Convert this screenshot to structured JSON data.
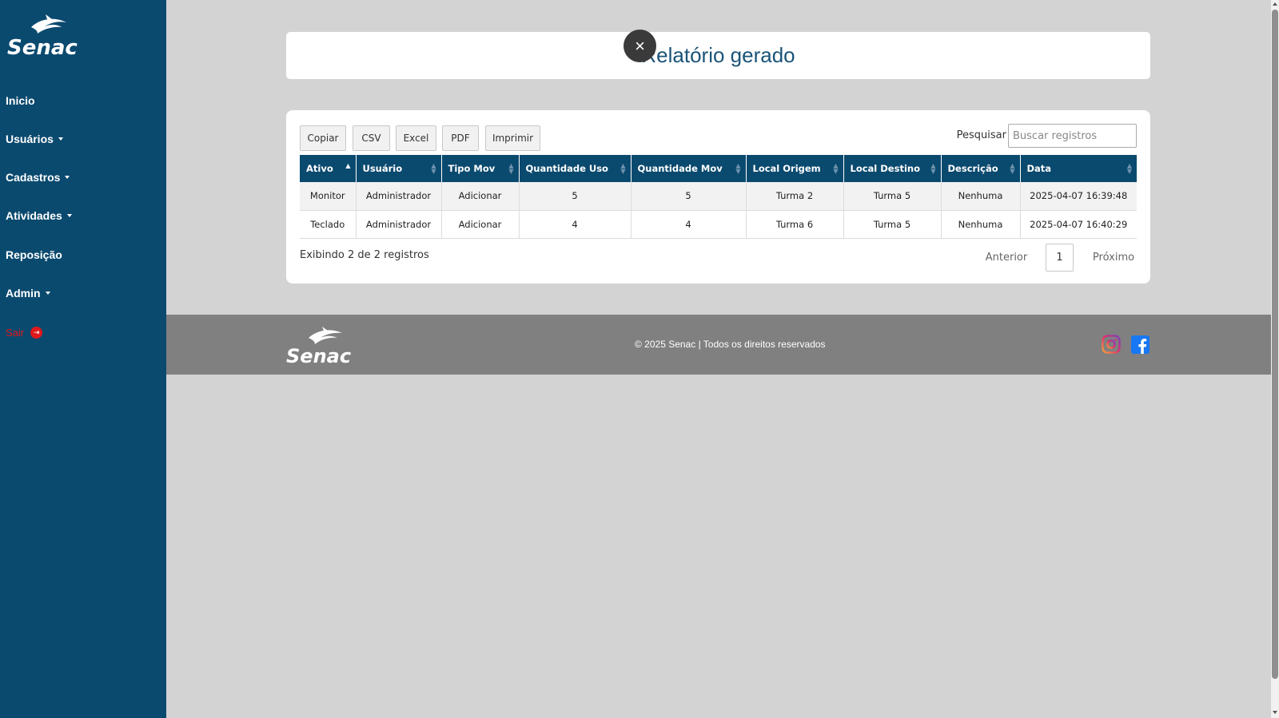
{
  "sidebar": {
    "brand": "Senac",
    "items": [
      {
        "label": "Inicio",
        "dropdown": false
      },
      {
        "label": "Usuários",
        "dropdown": true
      },
      {
        "label": "Cadastros",
        "dropdown": true
      },
      {
        "label": "Atividades",
        "dropdown": true
      },
      {
        "label": "Reposição",
        "dropdown": false
      },
      {
        "label": "Admin",
        "dropdown": true
      }
    ],
    "logout_label": "Sair"
  },
  "header": {
    "title": "Relatório gerado",
    "close_icon": "close-icon"
  },
  "toolbar": {
    "buttons": [
      "Copiar",
      "CSV",
      "Excel",
      "PDF",
      "Imprimir"
    ],
    "search_label": "Pesquisar",
    "search_placeholder": "Buscar registros"
  },
  "table": {
    "columns": [
      "Ativo",
      "Usuário",
      "Tipo Mov",
      "Quantidade Uso",
      "Quantidade Mov",
      "Local Origem",
      "Local Destino",
      "Descrição",
      "Data"
    ],
    "sorted_column": "Ativo",
    "rows": [
      [
        "Monitor",
        "Administrador",
        "Adicionar",
        "5",
        "5",
        "Turma 2",
        "Turma 5",
        "Nenhuma",
        "2025-04-07 16:39:48"
      ],
      [
        "Teclado",
        "Administrador",
        "Adicionar",
        "4",
        "4",
        "Turma 6",
        "Turma 5",
        "Nenhuma",
        "2025-04-07 16:40:29"
      ]
    ]
  },
  "pagination": {
    "info": "Exibindo 2 de 2 registros",
    "previous": "Anterior",
    "current_page": "1",
    "next": "Próximo"
  },
  "footer": {
    "brand": "Senac",
    "copyright": "© 2025 Senac | Todos os direitos reservados",
    "social_icons": [
      "instagram-icon",
      "facebook-icon"
    ]
  },
  "colors": {
    "sidebar": "#0b4a6f",
    "table_header": "#0b4a6f",
    "background": "#d3d3d3",
    "footer": "#808080",
    "logout": "#e0181b",
    "title": "#1a5478"
  }
}
